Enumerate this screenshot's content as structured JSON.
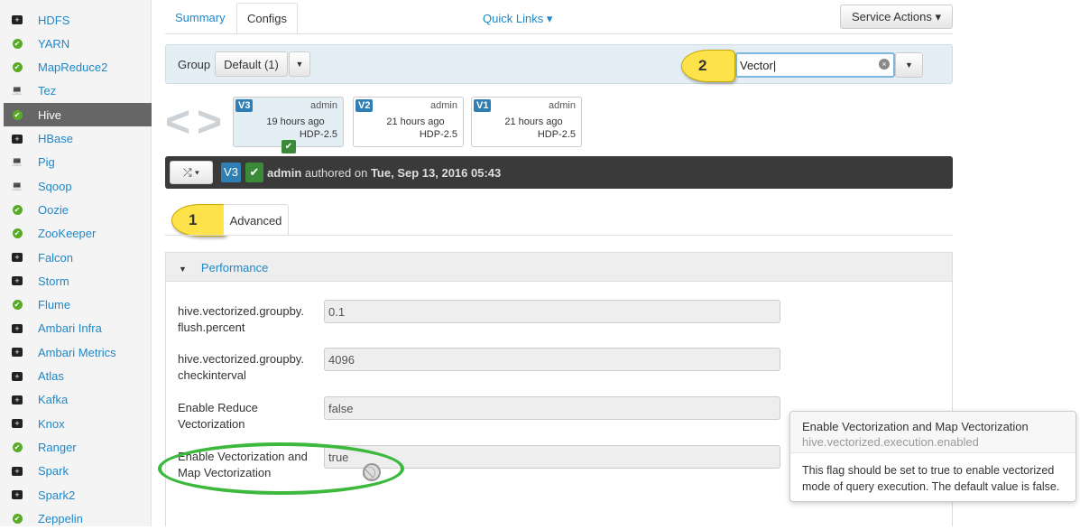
{
  "sidebar": {
    "items": [
      {
        "label": "HDFS",
        "icon": "briefcase-icon"
      },
      {
        "label": "YARN",
        "icon": "check-circle-icon"
      },
      {
        "label": "MapReduce2",
        "icon": "check-circle-icon"
      },
      {
        "label": "Tez",
        "icon": "laptop-icon"
      },
      {
        "label": "Hive",
        "icon": "check-circle-icon",
        "active": true
      },
      {
        "label": "HBase",
        "icon": "briefcase-icon"
      },
      {
        "label": "Pig",
        "icon": "laptop-icon"
      },
      {
        "label": "Sqoop",
        "icon": "laptop-icon"
      },
      {
        "label": "Oozie",
        "icon": "check-circle-icon"
      },
      {
        "label": "ZooKeeper",
        "icon": "check-circle-icon"
      },
      {
        "label": "Falcon",
        "icon": "briefcase-icon"
      },
      {
        "label": "Storm",
        "icon": "briefcase-icon"
      },
      {
        "label": "Flume",
        "icon": "check-circle-icon"
      },
      {
        "label": "Ambari Infra",
        "icon": "briefcase-icon"
      },
      {
        "label": "Ambari Metrics",
        "icon": "briefcase-icon"
      },
      {
        "label": "Atlas",
        "icon": "briefcase-icon"
      },
      {
        "label": "Kafka",
        "icon": "briefcase-icon"
      },
      {
        "label": "Knox",
        "icon": "briefcase-icon"
      },
      {
        "label": "Ranger",
        "icon": "check-circle-icon"
      },
      {
        "label": "Spark",
        "icon": "briefcase-icon"
      },
      {
        "label": "Spark2",
        "icon": "briefcase-icon"
      },
      {
        "label": "Zeppelin",
        "icon": "check-circle-icon"
      }
    ]
  },
  "tabs": {
    "summary": "Summary",
    "configs": "Configs",
    "quick_links": "Quick Links",
    "service_actions": "Service Actions"
  },
  "group": {
    "label": "Group",
    "value": "Default (1)"
  },
  "search": {
    "value": "Vector"
  },
  "callouts": {
    "one": "1",
    "two": "2"
  },
  "versions": [
    {
      "v": "V3",
      "user": "admin",
      "time": "19 hours ago",
      "stack": "HDP-2.5"
    },
    {
      "v": "V2",
      "user": "admin",
      "time": "21 hours ago",
      "stack": "HDP-2.5"
    },
    {
      "v": "V1",
      "user": "admin",
      "time": "21 hours ago",
      "stack": "HDP-2.5"
    }
  ],
  "current": {
    "v": "V3",
    "user": "admin",
    "text": "authored on",
    "date": "Tue, Sep 13, 2016 05:43"
  },
  "subtab": "Advanced",
  "section": "Performance",
  "props": [
    {
      "label": "hive.vectorized.groupby. flush.percent",
      "value": "0.1"
    },
    {
      "label": "hive.vectorized.groupby. checkinterval",
      "value": "4096"
    },
    {
      "label": "Enable Reduce Vectorization",
      "value": "false"
    },
    {
      "label": "Enable Vectorization and Map Vectorization",
      "value": "true"
    }
  ],
  "tooltip": {
    "title": "Enable Vectorization and Map Vectorization",
    "key": "hive.vectorized.execution.enabled",
    "body": "This flag should be set to true to enable vectorized mode of query execution. The default value is false."
  },
  "colors": {
    "link": "#1e88c9",
    "ok": "#5aaa2a",
    "highlight": "#3cb83c",
    "callout": "#fde24a"
  }
}
